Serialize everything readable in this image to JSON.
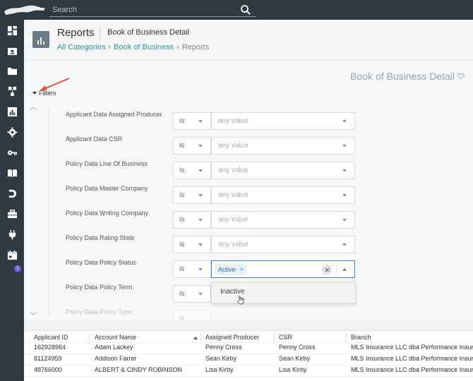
{
  "topbar": {
    "search_placeholder": "Search"
  },
  "header": {
    "title": "Reports",
    "subtitle": "Book of Business Detail",
    "breadcrumb": [
      "All Categories",
      "Book of Business",
      "Reports"
    ]
  },
  "report": {
    "title": "Book of Business Detail",
    "filters_label": "Filters"
  },
  "filters": [
    {
      "label": "Applicant Data Assigned Producer",
      "operator": "is",
      "value": "any value"
    },
    {
      "label": "Applicant Data CSR",
      "operator": "is",
      "value": "any value"
    },
    {
      "label": "Policy Data Line Of Business",
      "operator": "is",
      "value": "any value"
    },
    {
      "label": "Policy Data Master Company",
      "operator": "is",
      "value": "any value"
    },
    {
      "label": "Policy Data Writing Company",
      "operator": "is",
      "value": "any value"
    },
    {
      "label": "Policy Data Rating State",
      "operator": "is",
      "value": "any value"
    },
    {
      "label": "Policy Data Policy Status",
      "operator": "is",
      "chip": "Active",
      "chip_remove": "×"
    },
    {
      "label": "Policy Data Policy Term",
      "operator": "is"
    },
    {
      "label": "Policy Data Policy Type",
      "operator": "is"
    }
  ],
  "dropdown": {
    "options": [
      "Inactive"
    ]
  },
  "table": {
    "columns": [
      "Applicant ID",
      "Account Name",
      "Assigned Producer",
      "CSR",
      "Branch"
    ],
    "rows": [
      {
        "id": "162928964",
        "account": "Adam Lackey",
        "producer": "Penny Cross",
        "csr": "Penny Cross",
        "branch": "MLS Insurance LLC dba Performance Insurance"
      },
      {
        "id": "81124959",
        "account": "Addison Farrer",
        "producer": "Sean Kirby",
        "csr": "Sean Kirby",
        "branch": "MLS Insurance LLC dba Performance Insurance"
      },
      {
        "id": "48766000",
        "account": "ALBERT & CINDY ROBINSON",
        "producer": "Lisa Kirby",
        "csr": "Lisa Kirby",
        "branch": "MLS Insurance LLC dba Performance Insurance"
      }
    ]
  },
  "badge": {
    "count": "1"
  },
  "colors": {
    "sidebar": "#2f3941",
    "accent_link": "#2e9aa0",
    "chip_bg": "#e8f2fb",
    "chip_text": "#2767b0",
    "annotation_arrow": "#e0503a"
  }
}
